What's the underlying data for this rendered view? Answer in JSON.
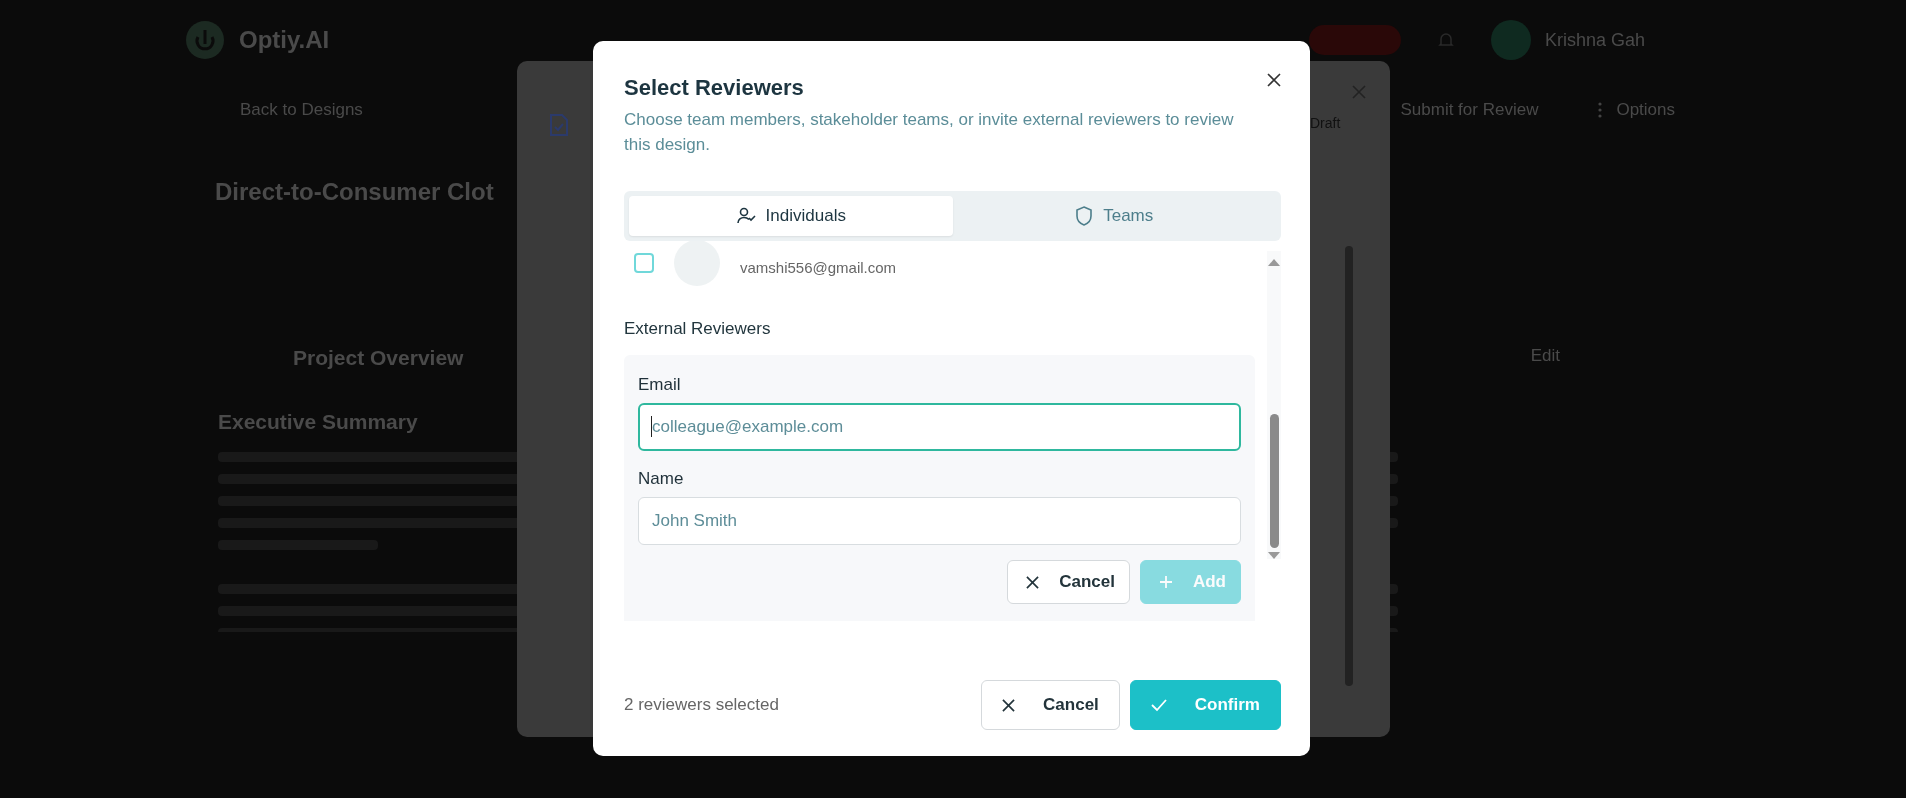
{
  "page": {
    "brand": "Optiy.AI",
    "user_name": "Krishna Gah",
    "back_link": "Back to Designs",
    "nav_actions": [
      {
        "label": "Submit for Review",
        "kind": "submit"
      },
      {
        "label": "Options",
        "kind": "options"
      }
    ],
    "project_title": "Direct-to-Consumer Clot",
    "section_title": "Project Overview",
    "edit_label": "Edit",
    "summary_heading": "Executive Summary"
  },
  "review_dialog": {
    "status": "Draft"
  },
  "modal": {
    "title": "Select Reviewers",
    "description": "Choose team members, stakeholder teams, or invite external reviewers to review this design.",
    "tabs": [
      {
        "label": "Individuals",
        "kind": "people",
        "selected": true
      },
      {
        "label": "Teams",
        "kind": "shield",
        "selected": false
      }
    ],
    "member": {
      "email": "vamshi556@gmail.com",
      "checked": false
    },
    "external_heading": "External Reviewers",
    "fields": [
      {
        "label": "Email",
        "placeholder": "colleague@example.com",
        "focused": true
      },
      {
        "label": "Name",
        "placeholder": "John Smith",
        "focused": false
      }
    ],
    "form_buttons": [
      {
        "label": "Cancel",
        "kind": "cancel",
        "disabled": false
      },
      {
        "label": "Add",
        "kind": "add",
        "disabled": true
      }
    ],
    "selected_count": "2 reviewers selected",
    "buttons": [
      {
        "label": "Cancel",
        "kind": "cancel"
      },
      {
        "label": "Confirm",
        "kind": "confirm"
      }
    ]
  }
}
